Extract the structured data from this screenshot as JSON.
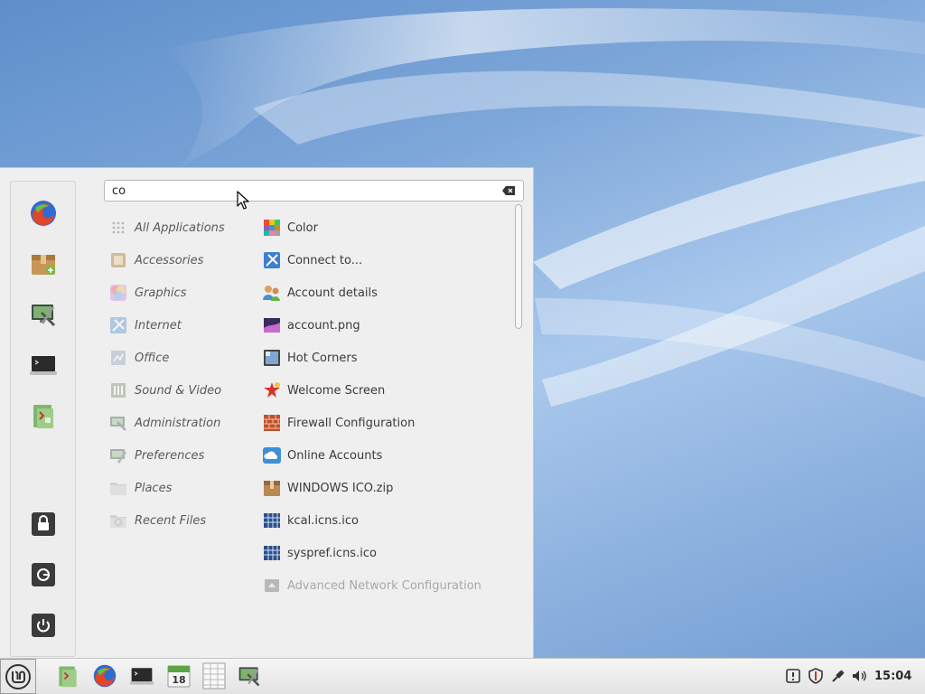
{
  "search": {
    "value": "co",
    "placeholder": ""
  },
  "favorites": [
    {
      "name": "firefox-icon"
    },
    {
      "name": "software-manager-icon"
    },
    {
      "name": "system-settings-icon"
    },
    {
      "name": "terminal-icon"
    },
    {
      "name": "files-icon"
    },
    {
      "name": "lock-screen-icon"
    },
    {
      "name": "logout-icon"
    },
    {
      "name": "power-icon"
    }
  ],
  "categories": [
    "All Applications",
    "Accessories",
    "Graphics",
    "Internet",
    "Office",
    "Sound & Video",
    "Administration",
    "Preferences",
    "Places",
    "Recent Files"
  ],
  "results": [
    "Color",
    "Connect to...",
    "Account details",
    "account.png",
    "Hot Corners",
    "Welcome Screen",
    "Firewall Configuration",
    "Online Accounts",
    "WINDOWS ICO.zip",
    "kcal.icns.ico",
    "syspref.icns.ico",
    "Advanced Network Configuration"
  ],
  "taskbar": {
    "calendar_day": "18",
    "clock": "15:04"
  },
  "colors": {
    "menu_bg": "#efefef",
    "taskbar_bg": "#e8e8e8",
    "wallpaper": "#6f9bd0"
  }
}
